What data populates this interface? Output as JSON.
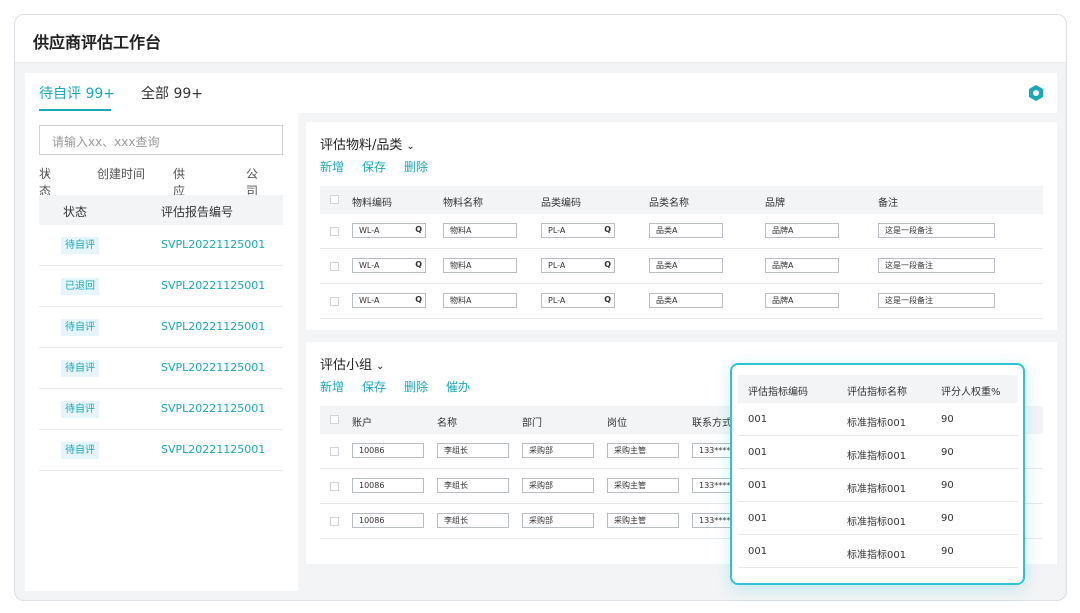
{
  "app": {
    "title": "供应商评估工作台"
  },
  "tabs": [
    {
      "label": "待自评 99+",
      "active": true
    },
    {
      "label": "全部 99+",
      "active": false
    }
  ],
  "accent_color": "#19a9b8",
  "settings_icon": "hexagon-settings-icon",
  "left": {
    "search_placeholder": "请输入xx、xxx查询",
    "filters": [
      "状态",
      "创建时间",
      "供应商",
      "公司"
    ],
    "columns": [
      "状态",
      "评估报告编号"
    ],
    "rows": [
      {
        "status": "待自评",
        "code": "SVPL20221125001"
      },
      {
        "status": "已退回",
        "code": "SVPL20221125001"
      },
      {
        "status": "待自评",
        "code": "SVPL20221125001"
      },
      {
        "status": "待自评",
        "code": "SVPL20221125001"
      },
      {
        "status": "待自评",
        "code": "SVPL20221125001"
      },
      {
        "status": "待自评",
        "code": "SVPL20221125001"
      }
    ]
  },
  "materials": {
    "title": "评估物料/品类",
    "actions": [
      "新增",
      "保存",
      "删除"
    ],
    "columns": [
      "物料编码",
      "物料名称",
      "品类编码",
      "品类名称",
      "品牌",
      "备注"
    ],
    "rows": [
      {
        "mat_code": "WL-A",
        "mat_name": "物料A",
        "cat_code": "PL-A",
        "cat_name": "品类A",
        "brand": "品牌A",
        "note": "这是一段备注"
      },
      {
        "mat_code": "WL-A",
        "mat_name": "物料A",
        "cat_code": "PL-A",
        "cat_name": "品类A",
        "brand": "品牌A",
        "note": "这是一段备注"
      },
      {
        "mat_code": "WL-A",
        "mat_name": "物料A",
        "cat_code": "PL-A",
        "cat_name": "品类A",
        "brand": "品牌A",
        "note": "这是一段备注"
      }
    ]
  },
  "team": {
    "title": "评估小组",
    "actions": [
      "新增",
      "保存",
      "删除",
      "催办"
    ],
    "columns": [
      "账户",
      "名称",
      "部门",
      "岗位",
      "联系方式"
    ],
    "rows": [
      {
        "account": "10086",
        "name": "李组长",
        "dept": "采购部",
        "post": "采购主管",
        "phone": "133****"
      },
      {
        "account": "10086",
        "name": "李组长",
        "dept": "采购部",
        "post": "采购主管",
        "phone": "133****"
      },
      {
        "account": "10086",
        "name": "李组长",
        "dept": "采购部",
        "post": "采购主管",
        "phone": "133****"
      }
    ]
  },
  "popup": {
    "columns": [
      "评估指标编码",
      "评估指标名称",
      "评分人权重%"
    ],
    "rows": [
      {
        "code": "001",
        "name": "标准指标001",
        "weight": "90"
      },
      {
        "code": "001",
        "name": "标准指标001",
        "weight": "90"
      },
      {
        "code": "001",
        "name": "标准指标001",
        "weight": "90"
      },
      {
        "code": "001",
        "name": "标准指标001",
        "weight": "90"
      },
      {
        "code": "001",
        "name": "标准指标001",
        "weight": "90"
      }
    ]
  }
}
